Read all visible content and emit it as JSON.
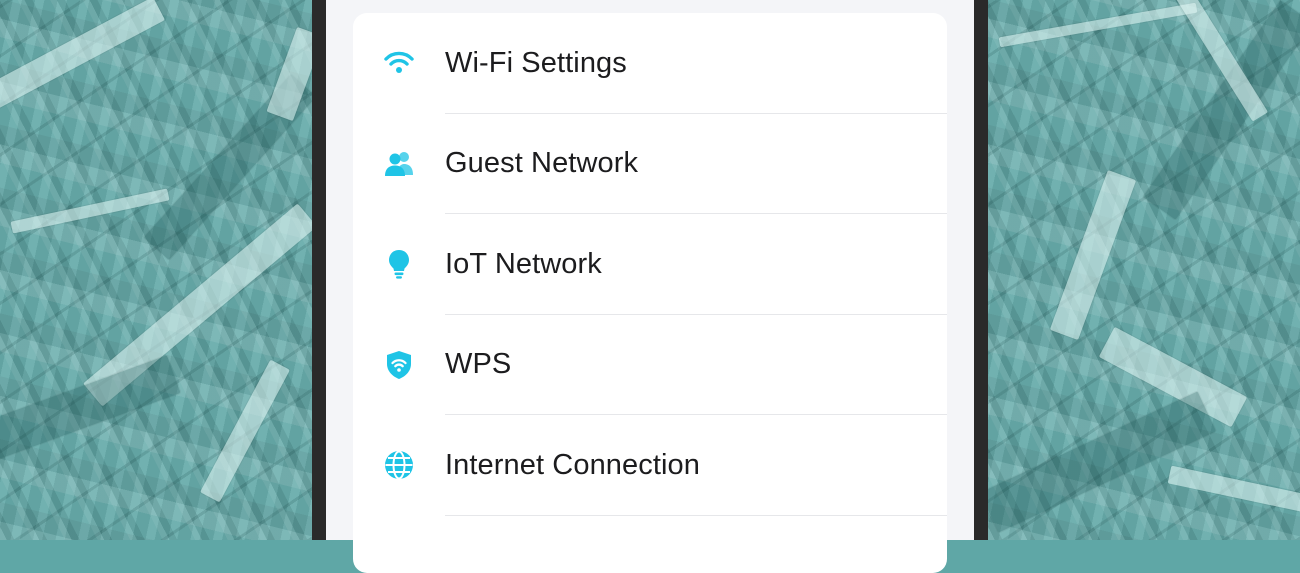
{
  "theme": {
    "accent": "#1fc4e6",
    "text": "#1c1c1e",
    "card_bg": "#ffffff",
    "screen_bg": "#f4f5f8"
  },
  "menu": {
    "items": [
      {
        "label": "Wi-Fi Settings",
        "icon": "wifi-icon"
      },
      {
        "label": "Guest Network",
        "icon": "guests-icon"
      },
      {
        "label": "IoT Network",
        "icon": "lightbulb-icon"
      },
      {
        "label": "WPS",
        "icon": "shield-wifi-icon"
      },
      {
        "label": "Internet Connection",
        "icon": "globe-icon"
      }
    ]
  }
}
